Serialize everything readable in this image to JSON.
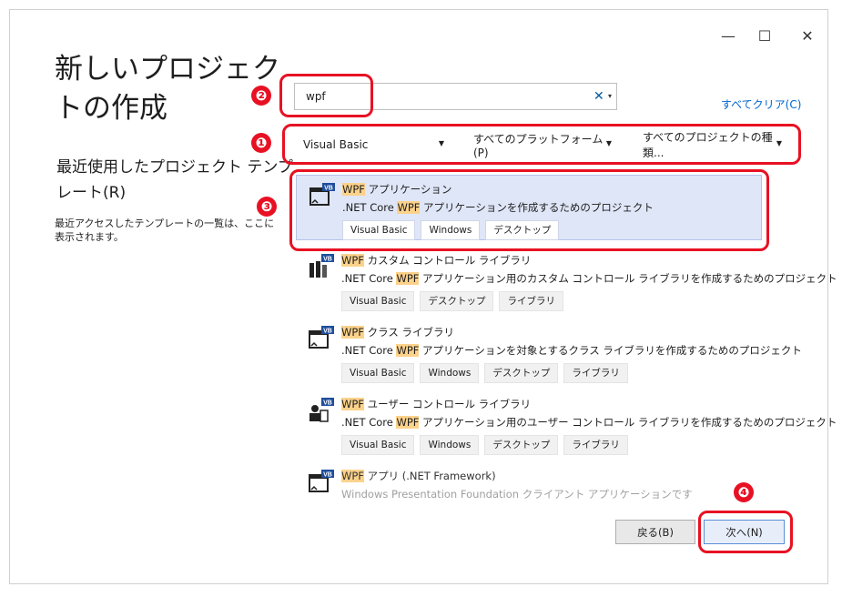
{
  "window": {
    "title": "新しいプロジェクトの作成",
    "controls": {
      "minimize": "—",
      "maximize": "☐",
      "close": "✕"
    }
  },
  "recent": {
    "title": "最近使用したプロジェクト テンプレート(R)",
    "description": "最近アクセスしたテンプレートの一覧は、ここに表示されます。"
  },
  "search": {
    "value": "wpf",
    "clear_glyph": "✕",
    "dropdown_glyph": "▾"
  },
  "clear_all": "すべてクリア(C)",
  "filters": [
    {
      "label": "Visual Basic"
    },
    {
      "label": "すべてのプラットフォーム(P)"
    },
    {
      "label": "すべてのプロジェクトの種類..."
    }
  ],
  "templates": [
    {
      "name_hl": "WPF",
      "name_rest": " アプリケーション",
      "desc_pre": ".NET Core ",
      "desc_hl": "WPF",
      "desc_post": " アプリケーションを作成するためのプロジェクト",
      "tags": [
        "Visual Basic",
        "Windows",
        "デスクトップ"
      ]
    },
    {
      "name_hl": "WPF",
      "name_rest": " カスタム コントロール ライブラリ",
      "desc_pre": ".NET Core ",
      "desc_hl": "WPF",
      "desc_post": " アプリケーション用のカスタム コントロール ライブラリを作成するためのプロジェクト",
      "tags": [
        "Visual Basic",
        "デスクトップ",
        "ライブラリ"
      ]
    },
    {
      "name_hl": "WPF",
      "name_rest": " クラス ライブラリ",
      "desc_pre": ".NET Core ",
      "desc_hl": "WPF",
      "desc_post": " アプリケーションを対象とするクラス ライブラリを作成するためのプロジェクト",
      "tags": [
        "Visual Basic",
        "Windows",
        "デスクトップ",
        "ライブラリ"
      ]
    },
    {
      "name_hl": "WPF",
      "name_rest": " ユーザー コントロール ライブラリ",
      "desc_pre": ".NET Core ",
      "desc_hl": "WPF",
      "desc_post": " アプリケーション用のユーザー コントロール ライブラリを作成するためのプロジェクト",
      "tags": [
        "Visual Basic",
        "Windows",
        "デスクトップ",
        "ライブラリ"
      ]
    },
    {
      "name_hl": "WPF",
      "name_rest": " アプリ (.NET Framework)",
      "desc_pre": "Windows Presentation Foundation クライアント アプリケーションです",
      "desc_hl": "",
      "desc_post": "",
      "tags": []
    }
  ],
  "buttons": {
    "back": "戻る(B)",
    "next": "次へ(N)"
  },
  "annotations": [
    "❶",
    "❷",
    "❸",
    "❹"
  ],
  "icon_badge": "VB",
  "colors": {
    "accent_red": "#e81123",
    "selection": "#dfe6f7",
    "highlight": "#fcd28b",
    "link": "#0066cc"
  }
}
